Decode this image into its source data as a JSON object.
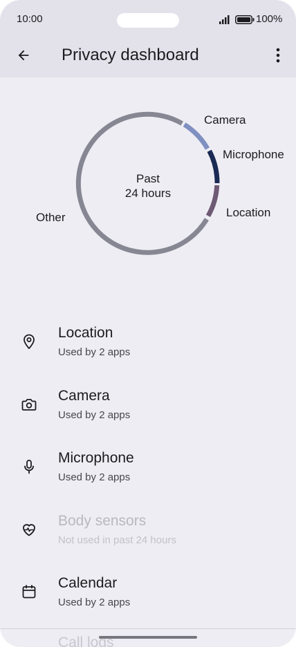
{
  "status_bar": {
    "time": "10:00",
    "battery": "100%"
  },
  "header": {
    "title": "Privacy dashboard",
    "back_icon": "arrow-back-icon",
    "more_icon": "more-vert-icon"
  },
  "usage_chart": {
    "center_label_line1": "Past",
    "center_label_line2": "24 hours",
    "segments": [
      {
        "label": "Camera",
        "color": "#7f90c0"
      },
      {
        "label": "Microphone",
        "color": "#1a2a55"
      },
      {
        "label": "Location",
        "color": "#6e5a75"
      },
      {
        "label": "Other",
        "color": "#868793"
      }
    ]
  },
  "permissions": [
    {
      "title": "Location",
      "subtitle": "Used by 2 apps",
      "icon": "location-pin-icon",
      "enabled": true
    },
    {
      "title": "Camera",
      "subtitle": "Used by 2 apps",
      "icon": "camera-icon",
      "enabled": true
    },
    {
      "title": "Microphone",
      "subtitle": "Used by 2 apps",
      "icon": "microphone-icon",
      "enabled": true
    },
    {
      "title": "Body sensors",
      "subtitle": "Not used in past 24 hours",
      "icon": "heart-pulse-icon",
      "enabled": false
    },
    {
      "title": "Calendar",
      "subtitle": "Used by 2 apps",
      "icon": "calendar-icon",
      "enabled": true
    },
    {
      "title": "Call logs",
      "subtitle": "",
      "icon": "",
      "enabled": true
    }
  ]
}
